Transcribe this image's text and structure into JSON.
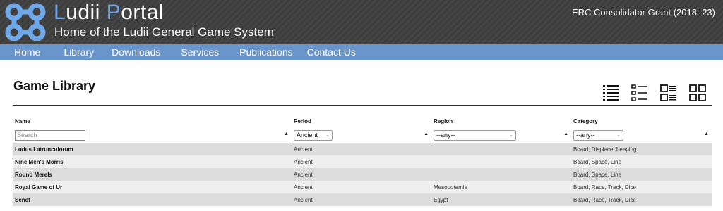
{
  "header": {
    "title_initial_1": "L",
    "title_rest_1": "udii ",
    "title_initial_2": "P",
    "title_rest_2": "ortal",
    "subtitle": "Home of the Ludii General Game System",
    "grant": "ERC Consolidator Grant (2018–23)",
    "logo_icon": "ludii-knot-logo-icon",
    "accent_color": "#6fa8e8"
  },
  "nav": {
    "items": [
      {
        "label": "Home"
      },
      {
        "label": "Library"
      },
      {
        "label": "Downloads"
      },
      {
        "label": "Services"
      },
      {
        "label": "Publications"
      },
      {
        "label": "Contact Us"
      }
    ],
    "color": "#6895cb"
  },
  "main": {
    "title": "Game Library",
    "view_icons": [
      "list-dense-icon",
      "list-bullets-icon",
      "grid-list-icon",
      "grid-tiles-icon"
    ]
  },
  "table": {
    "columns": [
      "Name",
      "Period",
      "Region",
      "Category"
    ],
    "filters": {
      "name_placeholder": "Search",
      "period_selected": "Ancient",
      "region_selected": "--any--",
      "category_selected": "--any--"
    },
    "rows": [
      {
        "name": "Ludus Latrunculorum",
        "period": "Ancient",
        "region": "",
        "category": "Board, Displace, Leaping"
      },
      {
        "name": "Nine Men's Morris",
        "period": "Ancient",
        "region": "",
        "category": "Board, Space, Line"
      },
      {
        "name": "Round Merels",
        "period": "Ancient",
        "region": "",
        "category": "Board, Space, Line"
      },
      {
        "name": "Royal Game of Ur",
        "period": "Ancient",
        "region": "Mesopotamia",
        "category": "Board, Race, Track, Dice"
      },
      {
        "name": "Senet",
        "period": "Ancient",
        "region": "Egypt",
        "category": "Board, Race, Track, Dice"
      }
    ]
  }
}
